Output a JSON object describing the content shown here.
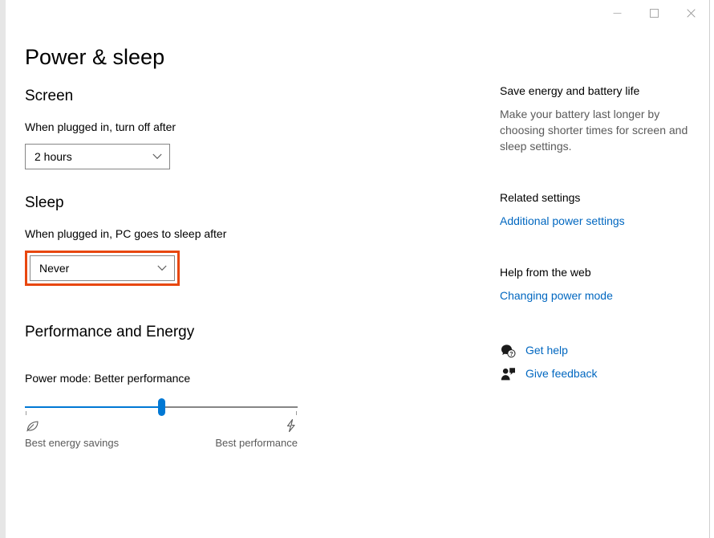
{
  "window": {
    "title": "Power & sleep",
    "caption_buttons": [
      {
        "name": "minimize",
        "glyph": "minimize-icon"
      },
      {
        "name": "maximize",
        "glyph": "maximize-icon"
      },
      {
        "name": "close",
        "glyph": "close-icon"
      }
    ]
  },
  "main": {
    "page_title": "Power & sleep",
    "screen": {
      "heading": "Screen",
      "field_label": "When plugged in, turn off after",
      "dropdown_value": "2 hours"
    },
    "sleep": {
      "heading": "Sleep",
      "field_label": "When plugged in, PC goes to sleep after",
      "dropdown_value": "Never",
      "highlight_color": "#e8470f"
    },
    "performance": {
      "heading": "Performance and Energy",
      "power_mode_label": "Power mode: Better performance",
      "slider": {
        "value_percent": 50,
        "left_icon": "leaf-icon",
        "right_icon": "lightning-bolt-icon",
        "left_label": "Best energy savings",
        "right_label": "Best performance",
        "fill_color": "#0078d4",
        "track_color": "#868686"
      }
    }
  },
  "sidebar": {
    "save_energy": {
      "heading": "Save energy and battery life",
      "body": "Make your battery last longer by choosing shorter times for screen and sleep settings."
    },
    "related": {
      "heading": "Related settings",
      "link": "Additional power settings"
    },
    "help_web": {
      "heading": "Help from the web",
      "link": "Changing power mode"
    },
    "help_links": [
      {
        "icon": "question-bubble-icon",
        "label": "Get help"
      },
      {
        "icon": "feedback-person-icon",
        "label": "Give feedback"
      }
    ],
    "link_color": "#0067c0"
  }
}
